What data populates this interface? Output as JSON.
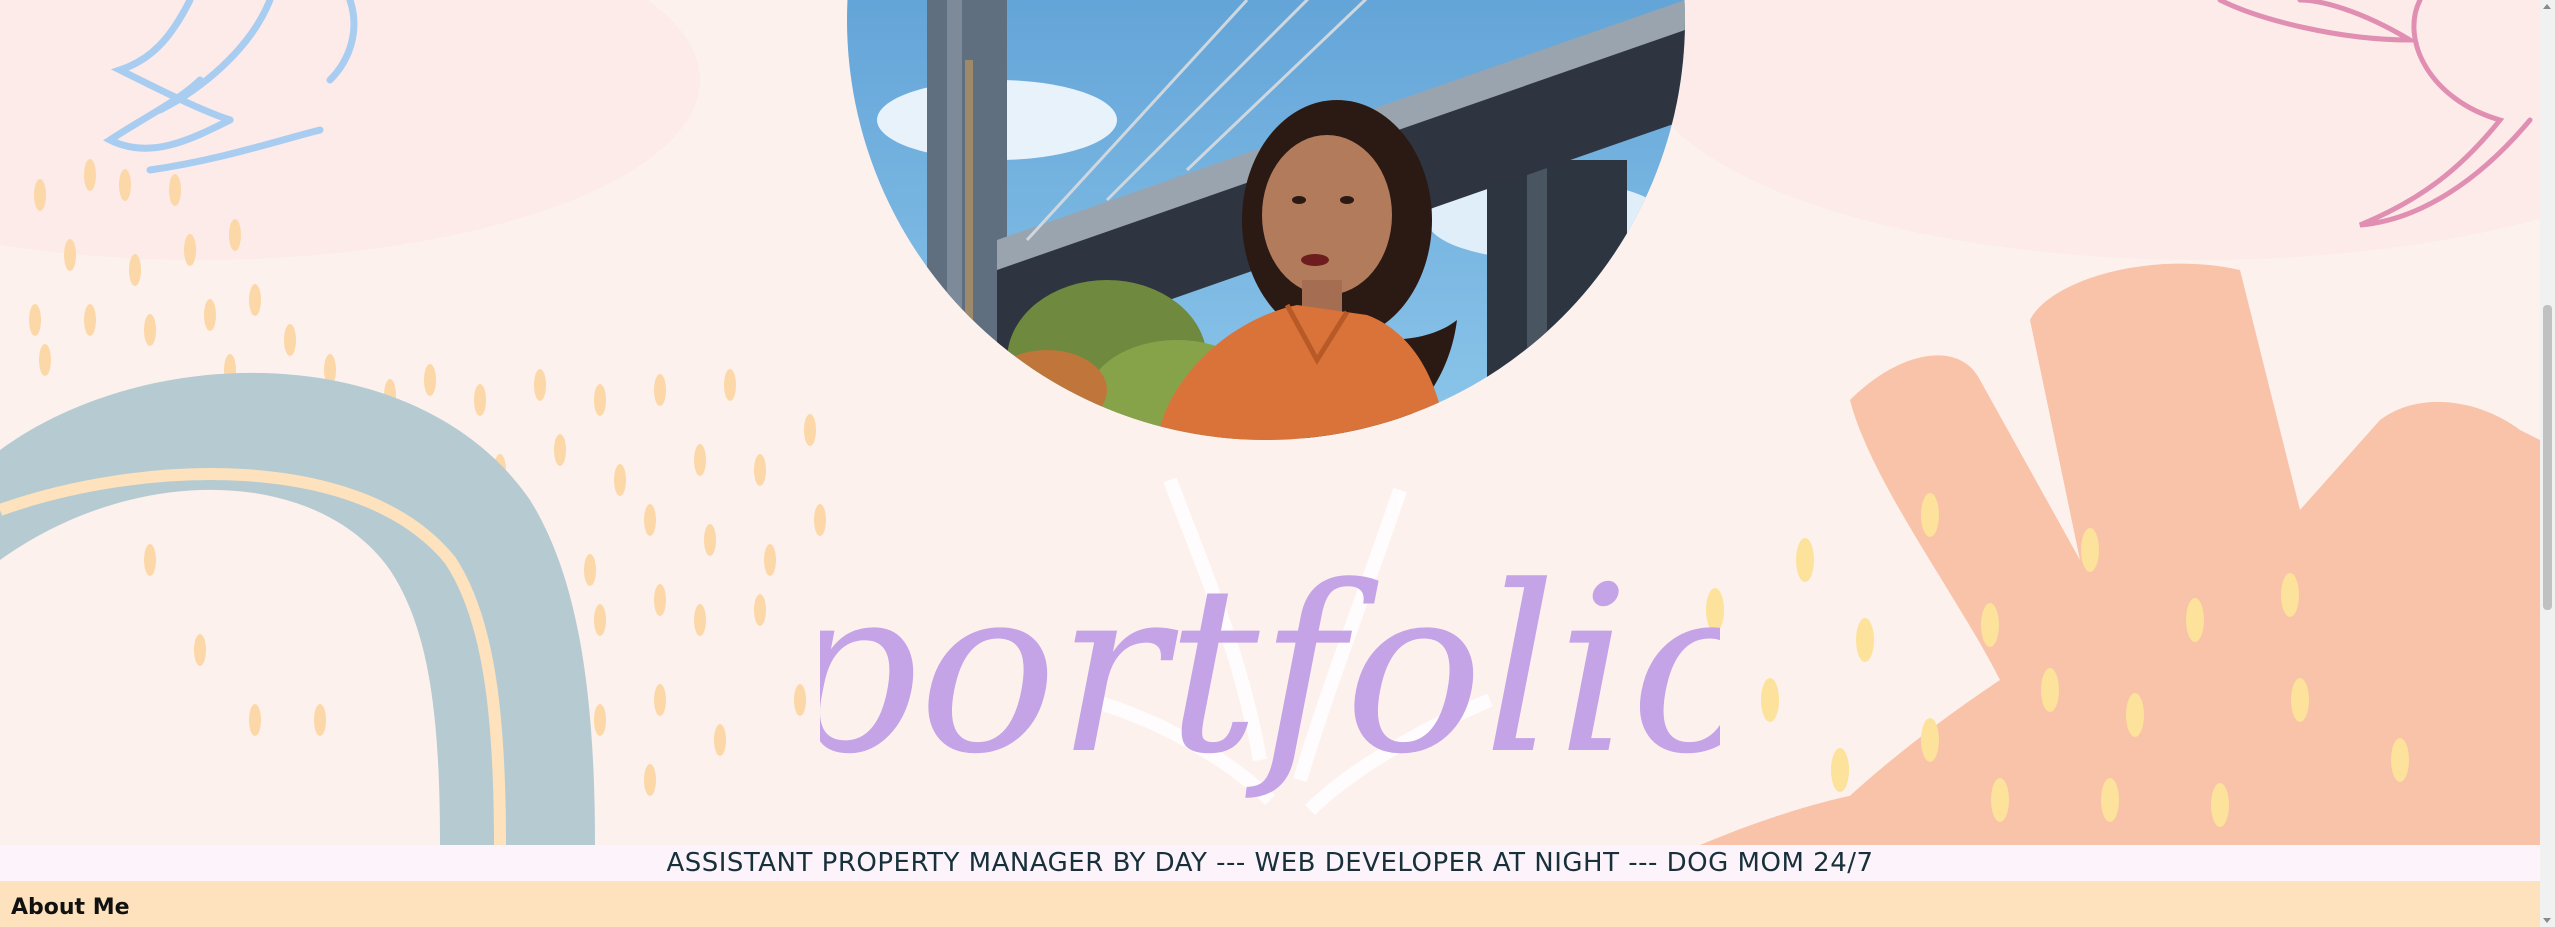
{
  "hero": {
    "title": "portfolio",
    "photo_alt": "Portrait in front of a suspension bridge"
  },
  "tagline": "ASSISTANT PROPERTY MANAGER BY DAY --- WEB DEVELOPER AT NIGHT --- DOG MOM 24/7",
  "nav": {
    "about_label": "About Me"
  },
  "colors": {
    "title_purple": "#c4a3e6",
    "tagline_bar": "#fcf3fb",
    "about_bar": "#fde2bd",
    "arch_blue": "#b6cbd1",
    "peach": "#f8c3a8",
    "pink_outline": "#e08fb2",
    "blue_outline": "#a9cdf0"
  }
}
